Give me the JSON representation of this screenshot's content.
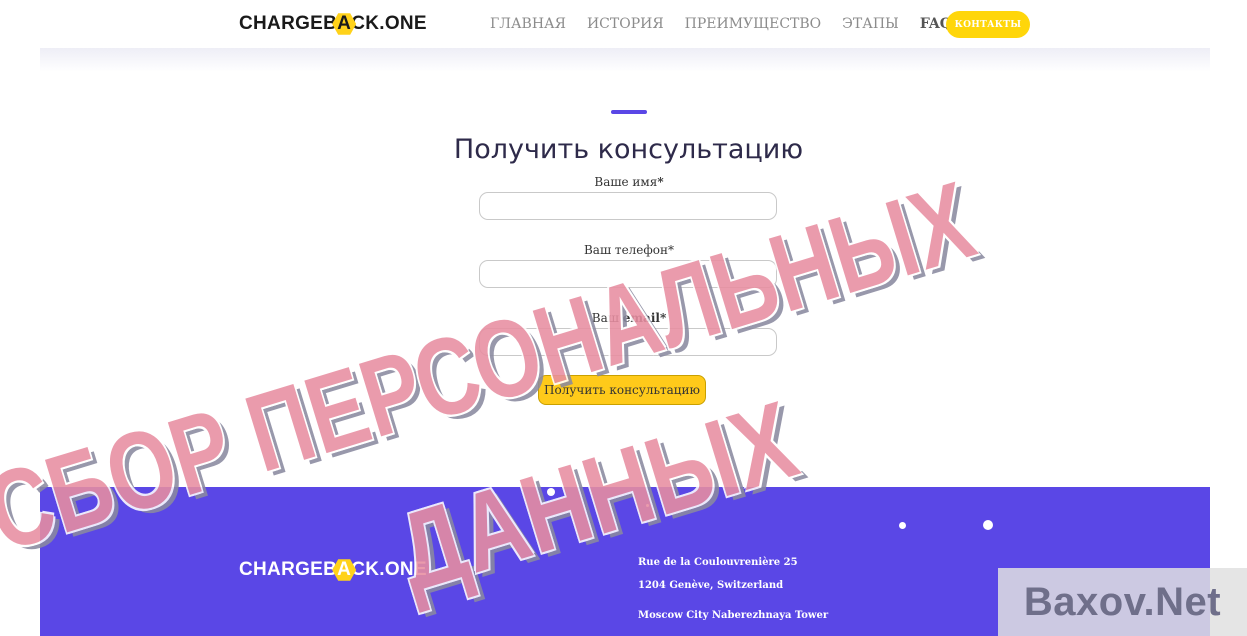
{
  "header": {
    "logo": {
      "prefix": "CHARGEB",
      "hex_letter": "A",
      "suffix": "CK.ONE"
    },
    "nav": [
      "ГЛАВНАЯ",
      "ИСТОРИЯ",
      "ПРЕИМУЩЕСТВО",
      "ЭТАПЫ",
      "FAQS"
    ],
    "contact_button": "КОНТАКТЫ"
  },
  "form": {
    "title": "Получить консультацию",
    "name_label": "Ваше имя",
    "phone_label": "Ваш телефон",
    "email_label_prefix": "Ваш ",
    "email_label_bold": "email",
    "required_mark": "*",
    "name_value": "",
    "phone_value": "",
    "email_value": "",
    "submit_label": "Получить консультацию"
  },
  "footer": {
    "logo": {
      "prefix": "CHARGEB",
      "hex_letter": "A",
      "suffix": "CK.ONE"
    },
    "address_lines": [
      "Rue de la Coulouvrenière 25",
      "1204 Genève, Switzerland",
      "Moscow City Naberezhnaya Tower"
    ]
  },
  "overlay": {
    "stamp_line1": "СБОР ПЕРСОНАЛЬНЫХ",
    "stamp_line2": "ДАННЫХ",
    "source_mark": "Baxov.Net"
  },
  "colors": {
    "accent_purple": "#5a47e6",
    "accent_yellow": "#ffd60a",
    "stamp_red": "#e88ea1"
  }
}
